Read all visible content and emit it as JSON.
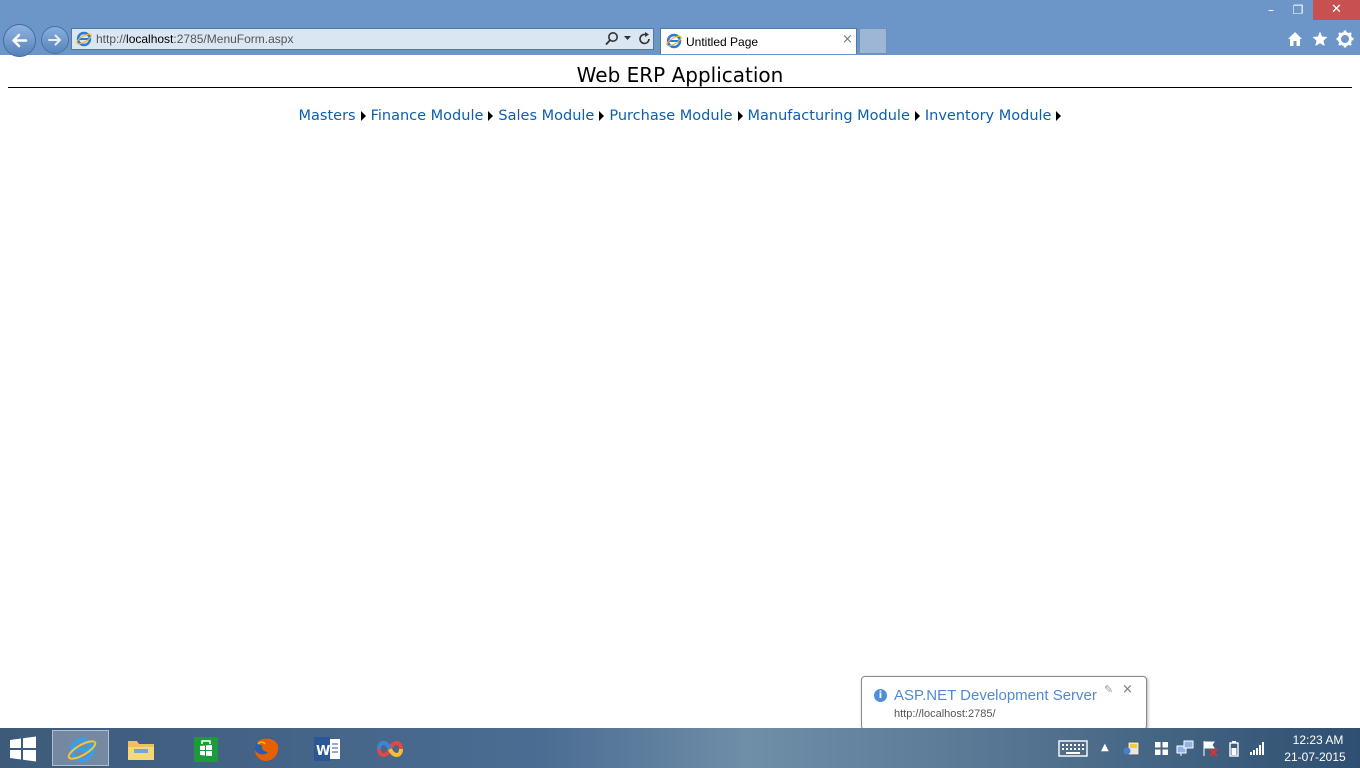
{
  "browser": {
    "window_controls": {
      "minimize": "–",
      "restore": "❐",
      "close": "✕"
    },
    "address": {
      "prefix": "http://",
      "host": "localhost",
      "rest": ":2785/MenuForm.aspx"
    },
    "tab": {
      "title": "Untitled Page",
      "close": "×"
    },
    "icons": [
      "back-icon",
      "forward-icon",
      "ie-icon",
      "search-icon",
      "dropdown-icon",
      "refresh-icon",
      "home-icon",
      "star-icon",
      "gear-icon"
    ]
  },
  "page": {
    "title": "Web ERP Application",
    "menu": [
      {
        "label": "Masters"
      },
      {
        "label": "Finance Module"
      },
      {
        "label": "Sales Module"
      },
      {
        "label": "Purchase Module"
      },
      {
        "label": "Manufacturing Module"
      },
      {
        "label": "Inventory Module"
      }
    ]
  },
  "notification": {
    "title": "ASP.NET Development Server",
    "url": "http://localhost:2785/",
    "close": "×"
  },
  "taskbar": {
    "apps": [
      "internet-explorer",
      "file-explorer",
      "store",
      "firefox",
      "word",
      "visual-studio"
    ],
    "clock": {
      "time": "12:23 AM",
      "date": "21-07-2015"
    }
  },
  "colors": {
    "chrome": "#6c96c8",
    "link": "#0c5fb0",
    "notify_title": "#4f8bd0"
  }
}
